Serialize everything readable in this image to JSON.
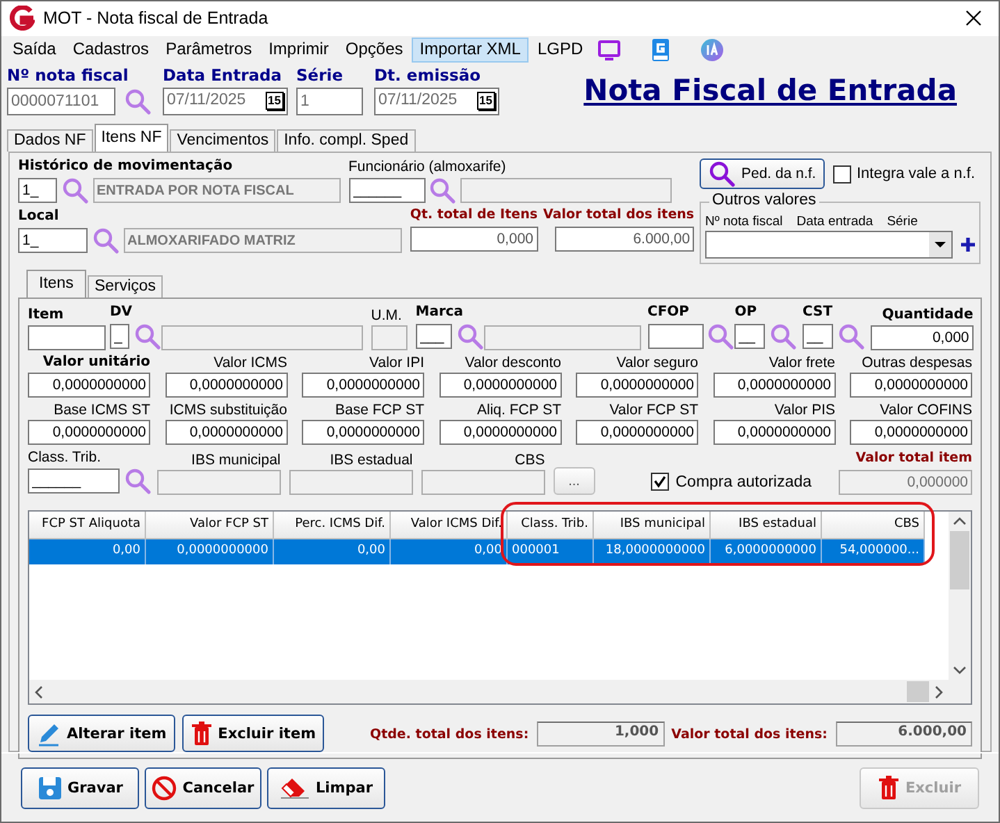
{
  "window": {
    "title": "MOT - Nota fiscal de Entrada"
  },
  "menu": [
    {
      "label": "Saída",
      "selected": false
    },
    {
      "label": "Cadastros",
      "selected": false
    },
    {
      "label": "Parâmetros",
      "selected": false
    },
    {
      "label": "Imprimir",
      "selected": false
    },
    {
      "label": "Opções",
      "selected": false
    },
    {
      "label": "Importar XML",
      "selected": true
    },
    {
      "label": "LGPD",
      "selected": false
    }
  ],
  "header": {
    "fields": [
      {
        "label": "Nº nota fiscal",
        "value": "0000071101",
        "lookup": true
      },
      {
        "label": "Data Entrada",
        "value": "07/11/2025",
        "calendar": "15"
      },
      {
        "label": "Série",
        "value": "1"
      },
      {
        "label": "Dt. emissão",
        "value": "07/11/2025",
        "calendar": "15"
      }
    ],
    "title": "Nota Fiscal de Entrada"
  },
  "tabs": [
    {
      "label": "Dados NF",
      "selected": false
    },
    {
      "label": "Itens NF",
      "selected": true
    },
    {
      "label": "Vencimentos",
      "selected": false
    },
    {
      "label": "Info. compl. Sped",
      "selected": false
    }
  ],
  "historico": {
    "label": "Histórico de movimentação",
    "code": "1_",
    "description": "ENTRADA POR NOTA FISCAL"
  },
  "funcionario": {
    "label": "Funcionário (almoxarife)",
    "code": "______"
  },
  "ped_button": "Ped. da n.f.",
  "integra": {
    "label": "Integra vale a n.f.",
    "checked": false
  },
  "local": {
    "label": "Local",
    "code": "1_",
    "description": "ALMOXARIFADO MATRIZ"
  },
  "qt_total": {
    "label": "Qt. total de Itens",
    "value": "0,000"
  },
  "valor_total": {
    "label": "Valor total dos itens",
    "value": "6.000,00"
  },
  "outros": {
    "title": "Outros valores",
    "columns": [
      "Nº nota fiscal",
      "Data entrada",
      "Série"
    ]
  },
  "inner_tabs": [
    {
      "label": "Itens",
      "selected": true
    },
    {
      "label": "Serviços",
      "selected": false
    }
  ],
  "item_row": [
    {
      "label": "Item",
      "bold": true
    },
    {
      "label": "DV",
      "bold": true,
      "value": "_",
      "lookup": true
    },
    {
      "disabled": true
    },
    {
      "label": "U.M.",
      "bold": false,
      "disabled": true
    },
    {
      "label": "Marca",
      "bold": true,
      "value": "___",
      "lookup": true
    },
    {
      "disabled": true
    },
    {
      "label": "CFOP",
      "bold": true,
      "lookup": true
    },
    {
      "label": "OP",
      "bold": true,
      "value": "__",
      "lookup": true
    },
    {
      "label": "CST",
      "bold": true,
      "value": "__",
      "lookup": true
    },
    {
      "label": "Quantidade",
      "bold": true,
      "value": "0,000"
    }
  ],
  "value_rows": [
    [
      {
        "label": "Valor unitário",
        "bold": true,
        "value": "0,0000000000"
      },
      {
        "label": "Valor ICMS",
        "bold": false,
        "value": "0,0000000000"
      },
      {
        "label": "Valor IPI",
        "bold": false,
        "value": "0,0000000000"
      },
      {
        "label": "Valor desconto",
        "bold": false,
        "value": "0,0000000000"
      },
      {
        "label": "Valor seguro",
        "bold": false,
        "value": "0,0000000000"
      },
      {
        "label": "Valor frete",
        "bold": false,
        "value": "0,0000000000"
      },
      {
        "label": "Outras despesas",
        "bold": false,
        "value": "0,0000000000"
      }
    ],
    [
      {
        "label": "Base ICMS ST",
        "bold": false,
        "value": "0,0000000000"
      },
      {
        "label": "ICMS substituição",
        "bold": false,
        "value": "0,0000000000"
      },
      {
        "label": "Base FCP ST",
        "bold": false,
        "value": "0,0000000000"
      },
      {
        "label": "Aliq. FCP ST",
        "bold": false,
        "value": "0,0000000000"
      },
      {
        "label": "Valor FCP ST",
        "bold": false,
        "value": "0,0000000000"
      },
      {
        "label": "Valor PIS",
        "bold": false,
        "value": "0,0000000000"
      },
      {
        "label": "Valor COFINS",
        "bold": false,
        "value": "0,0000000000"
      }
    ]
  ],
  "tax_row": [
    {
      "label": "Class. Trib.",
      "value": "______",
      "lookup": true
    },
    {
      "label": "IBS municipal",
      "disabled": true
    },
    {
      "label": "IBS estadual",
      "disabled": true
    },
    {
      "label": "CBS",
      "disabled": true
    }
  ],
  "more_button": "...",
  "compra": {
    "label": "Compra autorizada",
    "checked": true
  },
  "valor_total_item": {
    "label": "Valor total item",
    "value": "0,000000"
  },
  "grid": {
    "columns": [
      "FCP ST Aliquota",
      "Valor FCP ST",
      "Perc. ICMS Dif.",
      "Valor ICMS Dif.",
      "Class. Trib.",
      "IBS municipal",
      "IBS estadual",
      "CBS"
    ],
    "rows": [
      {
        "selected": true,
        "cells": [
          "0,00",
          "0,0000000000",
          "0,00",
          "0,00",
          "000001",
          "18,0000000000",
          "6,0000000000",
          "54,000000..."
        ]
      }
    ]
  },
  "item_buttons": [
    {
      "label": "Alterar item",
      "kind": "edit"
    },
    {
      "label": "Excluir item",
      "kind": "delete"
    }
  ],
  "totals": [
    {
      "label": "Qtde. total dos itens:",
      "value": "1,000"
    },
    {
      "label": "Valor total dos itens:",
      "value": "6.000,00"
    }
  ],
  "footer_buttons": [
    {
      "label": "Gravar",
      "kind": "save",
      "disabled": false
    },
    {
      "label": "Cancelar",
      "kind": "cancel",
      "disabled": false
    },
    {
      "label": "Limpar",
      "kind": "clear",
      "disabled": false
    },
    {
      "label": "Excluir",
      "kind": "delete",
      "disabled": true
    }
  ]
}
